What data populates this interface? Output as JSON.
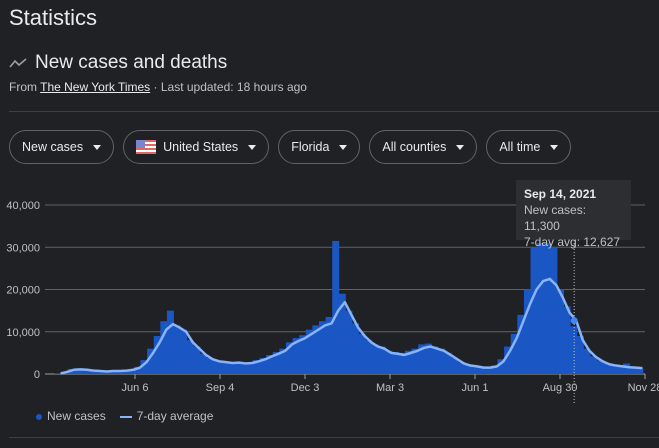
{
  "page_title": "Statistics",
  "section": {
    "icon": "trending-line-icon",
    "title": "New cases and deaths",
    "source_prefix": "From",
    "source_name": "The New York Times",
    "updated": "· Last updated: 18 hours ago"
  },
  "filters": [
    {
      "label": "New cases"
    },
    {
      "label": "United States",
      "icon": "us-flag-icon"
    },
    {
      "label": "Florida"
    },
    {
      "label": "All counties"
    },
    {
      "label": "All time"
    }
  ],
  "tooltip": {
    "date": "Sep 14, 2021",
    "new_cases": "New cases: 11,300",
    "avg": "7-day avg: 12,627"
  },
  "legend": {
    "bars": "New cases",
    "line": "7-day average"
  },
  "colors": {
    "bars": "#1a56c4",
    "line": "#8ab4f8",
    "background": "#202124"
  },
  "chart_data": {
    "type": "bar",
    "ylim": [
      0,
      40000
    ],
    "yticks": [
      "0",
      "10,000",
      "20,000",
      "30,000",
      "40,000"
    ],
    "yvals": [
      0,
      10000,
      20000,
      30000,
      40000
    ],
    "xticks": [
      {
        "label": "Jun 6",
        "date": "2020-06-06"
      },
      {
        "label": "Sep 4",
        "date": "2020-09-04"
      },
      {
        "label": "Dec 3",
        "date": "2020-12-03"
      },
      {
        "label": "Mar 3",
        "date": "2021-03-03"
      },
      {
        "label": "Jun 1",
        "date": "2021-06-01"
      },
      {
        "label": "Aug 30",
        "date": "2021-08-30"
      },
      {
        "label": "Nov 28",
        "date": "2021-11-28"
      }
    ],
    "xrange": [
      "2020-03-01",
      "2021-11-28"
    ],
    "highlight": {
      "date": "2021-09-14",
      "new_cases": 11300,
      "avg": 12627
    },
    "dates": [
      "2020-03-16",
      "2020-03-23",
      "2020-03-30",
      "2020-04-06",
      "2020-04-13",
      "2020-04-20",
      "2020-04-27",
      "2020-05-04",
      "2020-05-11",
      "2020-05-18",
      "2020-05-25",
      "2020-06-01",
      "2020-06-08",
      "2020-06-15",
      "2020-06-22",
      "2020-06-29",
      "2020-07-06",
      "2020-07-13",
      "2020-07-20",
      "2020-07-27",
      "2020-08-03",
      "2020-08-10",
      "2020-08-17",
      "2020-08-24",
      "2020-08-31",
      "2020-09-07",
      "2020-09-14",
      "2020-09-21",
      "2020-09-28",
      "2020-10-05",
      "2020-10-12",
      "2020-10-19",
      "2020-10-26",
      "2020-11-02",
      "2020-11-09",
      "2020-11-16",
      "2020-11-23",
      "2020-11-30",
      "2020-12-07",
      "2020-12-14",
      "2020-12-21",
      "2020-12-28",
      "2021-01-04",
      "2021-01-11",
      "2021-01-18",
      "2021-01-25",
      "2021-02-01",
      "2021-02-08",
      "2021-02-15",
      "2021-02-22",
      "2021-03-01",
      "2021-03-08",
      "2021-03-15",
      "2021-03-22",
      "2021-03-29",
      "2021-04-05",
      "2021-04-12",
      "2021-04-19",
      "2021-04-26",
      "2021-05-03",
      "2021-05-10",
      "2021-05-17",
      "2021-05-24",
      "2021-05-31",
      "2021-06-07",
      "2021-06-14",
      "2021-06-21",
      "2021-06-28",
      "2021-07-05",
      "2021-07-12",
      "2021-07-19",
      "2021-07-26",
      "2021-08-02",
      "2021-08-09",
      "2021-08-16",
      "2021-08-23",
      "2021-08-30",
      "2021-09-06",
      "2021-09-13",
      "2021-09-20",
      "2021-09-27",
      "2021-10-04",
      "2021-10-11",
      "2021-10-18",
      "2021-10-25",
      "2021-11-01",
      "2021-11-08",
      "2021-11-15",
      "2021-11-22"
    ],
    "series": [
      {
        "name": "New cases",
        "values": [
          100,
          600,
          1200,
          1100,
          1000,
          900,
          700,
          600,
          800,
          700,
          900,
          1100,
          1700,
          3300,
          6000,
          9000,
          12500,
          15000,
          11500,
          10500,
          8000,
          6500,
          4800,
          3800,
          3200,
          3000,
          2800,
          2900,
          2600,
          2800,
          3300,
          3800,
          4500,
          5200,
          6000,
          7500,
          8500,
          9200,
          10500,
          11500,
          12500,
          13500,
          31500,
          19000,
          15000,
          12000,
          9500,
          8000,
          7000,
          6500,
          5500,
          5200,
          5000,
          5500,
          6000,
          7000,
          7200,
          6500,
          6000,
          5000,
          3800,
          2700,
          2200,
          2000,
          1600,
          1600,
          2000,
          3500,
          6500,
          9500,
          14000,
          20000,
          30000,
          31000,
          31000,
          30000,
          20000,
          16000,
          11300,
          9000,
          6000,
          4200,
          3200,
          2500,
          2100,
          1900,
          2500,
          1600,
          1500
        ]
      },
      {
        "name": "7-day average",
        "values": [
          100,
          500,
          1000,
          1100,
          1000,
          800,
          700,
          600,
          700,
          700,
          800,
          1000,
          1500,
          2800,
          5000,
          7500,
          10500,
          11800,
          11000,
          10000,
          7500,
          6000,
          4500,
          3500,
          3000,
          2800,
          2600,
          2700,
          2500,
          2600,
          3000,
          3500,
          4200,
          4800,
          5500,
          7000,
          7800,
          8500,
          9500,
          10500,
          11500,
          12000,
          15000,
          17000,
          14000,
          11000,
          9000,
          7500,
          6500,
          6000,
          5000,
          4800,
          4500,
          5000,
          5500,
          6200,
          6500,
          6000,
          5500,
          4500,
          3500,
          2500,
          2000,
          1800,
          1500,
          1500,
          1800,
          3000,
          5500,
          8500,
          12500,
          16500,
          20000,
          22000,
          22500,
          21000,
          18000,
          14500,
          12627,
          8000,
          5500,
          4000,
          3000,
          2300,
          2000,
          1800,
          1600,
          1500,
          1400
        ]
      }
    ]
  }
}
